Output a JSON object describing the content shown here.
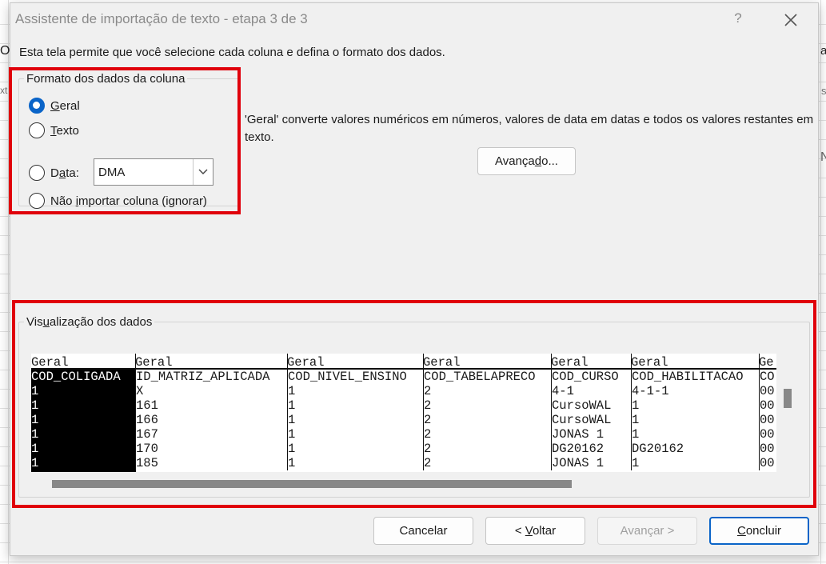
{
  "dialog": {
    "title": "Assistente de importação de texto - etapa 3 de 3",
    "help_label": "?",
    "close_label": "✕",
    "instruction": "Esta tela permite que você selecione cada coluna e defina o formato dos dados."
  },
  "format_group": {
    "legend": "Formato dos dados da coluna",
    "options": [
      {
        "label": "Geral",
        "checked": true
      },
      {
        "label": "Texto",
        "checked": false
      },
      {
        "label": "Data:",
        "checked": false
      },
      {
        "label": "Não importar coluna (ignorar)",
        "checked": false
      }
    ],
    "date_select_value": "DMA"
  },
  "description": "'Geral' converte valores numéricos em números, valores de data em datas e todos os valores restantes em texto.",
  "buttons": {
    "advanced": "Avançado...",
    "cancel": "Cancelar",
    "back": "< Voltar",
    "next": "Avançar >",
    "finish": "Concluir"
  },
  "preview": {
    "legend": "Visualização dos dados",
    "columns": [
      {
        "format": "Geral",
        "cells": [
          "COD_COLIGADA",
          "1",
          "1",
          "1",
          "1",
          "1",
          "1"
        ]
      },
      {
        "format": "Geral",
        "cells": [
          "ID_MATRIZ_APLICADA",
          "X",
          "161",
          "166",
          "167",
          "170",
          "185"
        ]
      },
      {
        "format": "Geral",
        "cells": [
          "COD_NIVEL_ENSINO",
          "1",
          "1",
          "1",
          "1",
          "1",
          "1"
        ]
      },
      {
        "format": "Geral",
        "cells": [
          "COD_TABELAPRECO",
          "2",
          "2",
          "2",
          "2",
          "2",
          "2"
        ]
      },
      {
        "format": "Geral",
        "cells": [
          "COD_CURSO",
          "4-1",
          "CursoWAL",
          "CursoWAL",
          "JONAS 1",
          "DG20162",
          "JONAS 1"
        ]
      },
      {
        "format": "Geral",
        "cells": [
          "COD_HABILITACAO",
          "4-1-1",
          "1",
          "1",
          "1",
          "DG20162",
          "1"
        ]
      },
      {
        "format": "Ge",
        "cells": [
          "CO",
          "00",
          "00",
          "00",
          "00",
          "00",
          "00"
        ]
      }
    ]
  },
  "background_sheet": {
    "fragments": [
      "O",
      "xt",
      "a",
      "s",
      "N"
    ]
  }
}
